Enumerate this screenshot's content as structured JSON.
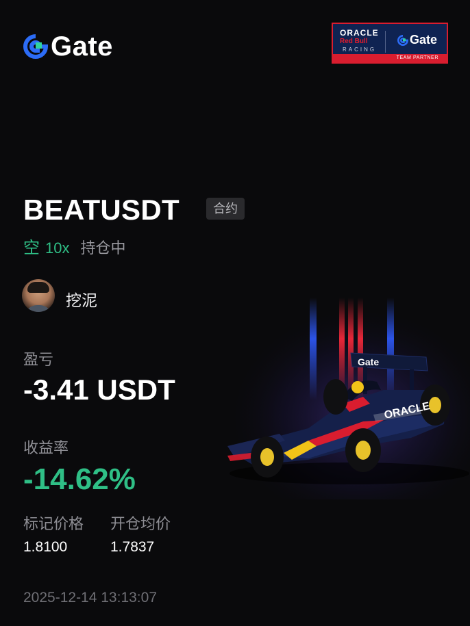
{
  "brand": {
    "name": "Gate",
    "accent": "#2c6cf6",
    "icon": "gate-logo-icon"
  },
  "partner": {
    "oracle": "ORACLE",
    "red_bull": "Red Bull",
    "racing": "RACING",
    "gate": "Gate",
    "tagline": "TEAM PARTNER"
  },
  "position": {
    "symbol": "BEATUSDT",
    "type": "合约",
    "side": "空",
    "leverage": "10x",
    "status": "持仓中"
  },
  "user": {
    "name": "挖泥",
    "avatar_icon": "avatar"
  },
  "stats": {
    "pnl_label": "盈亏",
    "pnl_value": "-3.41 USDT",
    "roi_label": "收益率",
    "roi_value": "-14.62%",
    "mark_price_label": "标记价格",
    "mark_price_value": "1.8100",
    "entry_price_label": "开仓均价",
    "entry_price_value": "1.7837"
  },
  "timestamp": "2025-12-14 13:13:07",
  "colors": {
    "positive_green": "#2fbf86",
    "background": "#0a0a0c",
    "red": "#d91d2f",
    "navy": "#0f2352"
  },
  "art": {
    "car_icon": "f1-car-illustration"
  }
}
